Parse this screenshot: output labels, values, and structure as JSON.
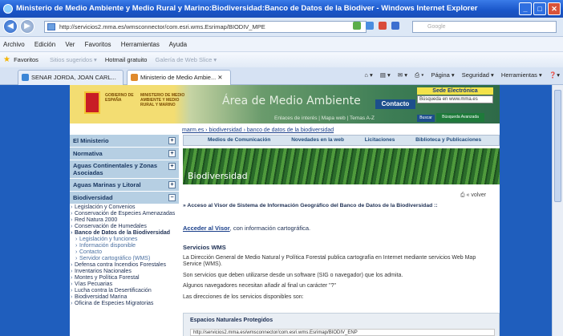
{
  "window": {
    "title": "Ministerio de Medio Ambiente y Medio Rural y Marino:Biodiversidad:Banco de Datos de la Biodiver - Windows Internet Explorer"
  },
  "address": {
    "url": "http://servicios2.mma.es/wmsconnector/com.esri.wms.Esrimap/BIODIV_MPE",
    "search_placeholder": "Google"
  },
  "menu": [
    "Archivo",
    "Edición",
    "Ver",
    "Favoritos",
    "Herramientas",
    "Ayuda"
  ],
  "favbar": {
    "favoritos": "Favoritos",
    "sitios": "Sitios sugeridos ▾",
    "hotmail": "Hotmail gratuito",
    "galeria": "Galería de Web Slice ▾"
  },
  "tabs": [
    {
      "label": "SENAR JORDA, JOAN CARL..."
    },
    {
      "label": "Ministerio de Medio Ambie... ✕"
    }
  ],
  "tools": {
    "pagina": "Página ▾",
    "seguridad": "Seguridad ▾",
    "herramientas": "Herramientas ▾"
  },
  "header": {
    "gobierno": "GOBIERNO DE ESPAÑA",
    "ministerio": "MINISTERIO DE MEDIO AMBIENTE Y MEDIO RURAL Y MARINO",
    "area": "Área de Medio Ambiente",
    "contacto": "Contacto",
    "sede": "Sede Electrónica",
    "busqueda": "Búsqueda en www.mma.es",
    "buscar": "Buscar",
    "avanzada": "Búsqueda Avanzada",
    "links": "Enlaces de interés  |  Mapa web  |  Temas A-Z"
  },
  "breadcrumb": "marm.es › biodiversidad › banco de datos de la biodiversidad",
  "sidebar": {
    "ministerio": "El Ministerio",
    "normativa": "Normativa",
    "aguas_cont": "Aguas Continentales y Zonas Asociadas",
    "aguas_mar": "Aguas Marinas y Litoral",
    "biodiversidad": "Biodiversidad",
    "items": [
      "Legislación y Convenios",
      "Conservación de Especies Amenazadas",
      "Red Natura 2000",
      "Conservación de Humedales"
    ],
    "banco": "Banco de Datos de la Biodiversidad",
    "sub": [
      "Legislación y funciones",
      "Información disponible",
      "Contacto",
      "Servidor cartográfico (WMS)"
    ],
    "rest": [
      "Defensa contra Incendios Forestales",
      "Inventarios Nacionales",
      "Montes y Política Forestal",
      "Vías Pecuarias",
      "Lucha contra la Desertificación",
      "Biodiversidad Marina",
      "Oficina de Especies Migratorias"
    ]
  },
  "topnav": [
    "Medios de Comunicación",
    "Novedades en la web",
    "Licitaciones",
    "Biblioteca y Publicaciones"
  ],
  "banner": "Biodiversidad",
  "volver": "« volver",
  "visor": "Acceso al Visor de Sistema de Información Geográfico del Banco de Datos de la Biodiversidad ::",
  "acceder": {
    "link": "Acceder al Visor",
    "text": ", con información cartográfica."
  },
  "wms": {
    "title": "Servicios WMS",
    "p1": "La Dirección General de Medio Natural y Política Forestal publica cartografía en Internet mediante servicios Web Map Service (WMS).",
    "p2": "Son servicios que deben utilizarse desde un software (SIG o navegador) que los admita.",
    "p3": "Algunos navegadores necesitan añadir al final un carácter \"?\"",
    "p4": "Las direcciones de los servicios disponibles son:"
  },
  "espacios": {
    "title": "Espacios Naturales Protegidos",
    "url": "http://servicios2.mma.es/wmsconnector/com.esri.wms.Esrimap/BIODIV_ENP"
  }
}
